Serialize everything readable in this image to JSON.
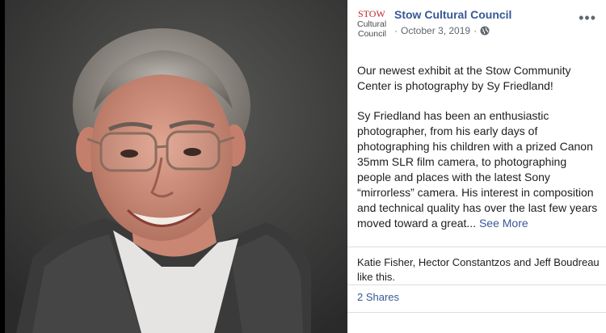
{
  "page": {
    "name": "Stow Cultural Council",
    "logo_line1": "STOW",
    "logo_line2": "Cultural",
    "logo_line3": "Council"
  },
  "post": {
    "date": "October 3, 2019",
    "separator": "·",
    "privacy_icon": "globe-icon",
    "more_icon": "more-options-icon",
    "paragraph1": "Our newest exhibit at the Stow Community Center is photography by Sy Friedland!",
    "paragraph2": "Sy Friedland has been an enthusiastic photographer, from his early days of photographing his children with a prized Canon 35mm SLR film camera, to photographing people and places with the latest Sony “mirrorless” camera. His interest in composition and technical quality has over the last few years moved toward a great...",
    "see_more": "See More"
  },
  "engagement": {
    "likes_text": "Katie Fisher, Hector Constantzos and Jeff Boudreau like this.",
    "shares": "2 Shares"
  },
  "colors": {
    "link": "#385898",
    "text": "#1c1e21",
    "meta": "#616770",
    "logo_red": "#c0272d"
  }
}
